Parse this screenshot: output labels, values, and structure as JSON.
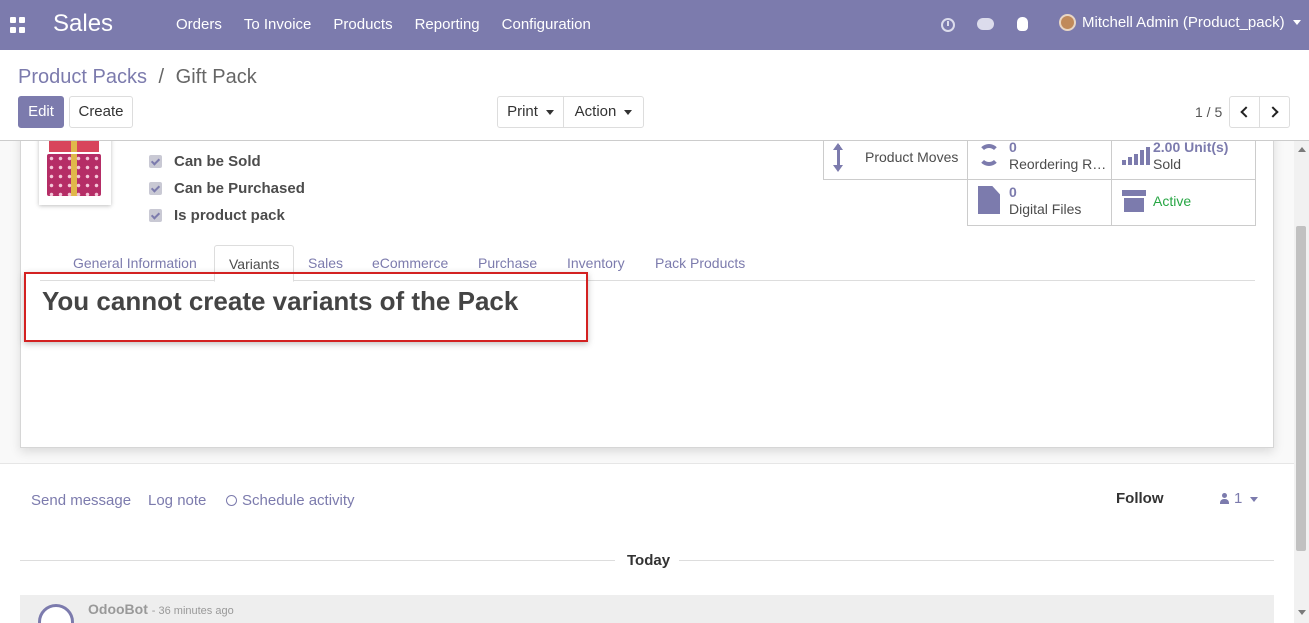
{
  "navbar": {
    "app_name": "Sales",
    "menu": [
      "Orders",
      "To Invoice",
      "Products",
      "Reporting",
      "Configuration"
    ],
    "user_label": "Mitchell Admin (Product_pack)",
    "icons": [
      "apps-icon",
      "clock-icon",
      "chat-icon",
      "bug-icon",
      "avatar",
      "caret-down-icon"
    ]
  },
  "breadcrumb": {
    "parent": "Product Packs",
    "separator": "/",
    "current": "Gift Pack"
  },
  "buttons": {
    "edit": "Edit",
    "create": "Create",
    "print": "Print",
    "action": "Action"
  },
  "pager": {
    "value": "1 / 5"
  },
  "product": {
    "checkboxes": [
      {
        "label": "Can be Sold",
        "checked": true
      },
      {
        "label": "Can be Purchased",
        "checked": true
      },
      {
        "label": "Is product pack",
        "checked": true
      }
    ]
  },
  "stats": {
    "moves_label": "Product Moves",
    "reorder_count": "0",
    "reorder_label": "Reordering Rules",
    "sold_value": "2.00 Unit(s)",
    "sold_label": "Sold",
    "files_count": "0",
    "files_label": "Digital Files",
    "active_label": "Active"
  },
  "tabs": [
    {
      "label": "General Information",
      "active": false
    },
    {
      "label": "Variants",
      "active": true
    },
    {
      "label": "Sales",
      "active": false
    },
    {
      "label": "eCommerce",
      "active": false
    },
    {
      "label": "Purchase",
      "active": false
    },
    {
      "label": "Inventory",
      "active": false
    },
    {
      "label": "Pack Products",
      "active": false
    }
  ],
  "variants_notice": "You cannot create variants of the Pack",
  "chatter": {
    "send_message": "Send message",
    "log_note": "Log note",
    "schedule_activity": "Schedule activity",
    "follow": "Follow",
    "followers_count": "1",
    "date_separator": "Today",
    "message": {
      "author": "OdooBot",
      "time": "- 36 minutes ago"
    }
  },
  "colors": {
    "brand": "#7c7bad",
    "active_status": "#28a745",
    "notice_border": "#d32121"
  }
}
